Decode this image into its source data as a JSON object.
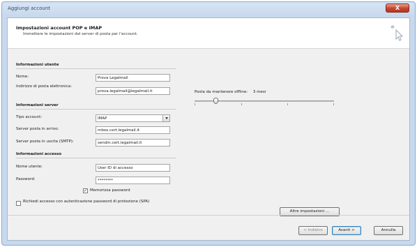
{
  "window": {
    "title": "Aggiungi account",
    "close_label": "X"
  },
  "header": {
    "title": "Impostazioni account POP e IMAP",
    "subtitle": "Immettere le impostazioni del server di posta per l'account."
  },
  "user_info": {
    "heading": "Informazioni utente",
    "name_label": "Nome:",
    "name_value": "Prova Legalmail",
    "email_label": "Indirizzo di posta elettronica:",
    "email_value": "prova.legalmail@legalmail.it"
  },
  "server_info": {
    "heading": "Informazioni server",
    "type_label": "Tipo account:",
    "type_value": "IMAP",
    "incoming_label": "Server posta in arrivo:",
    "incoming_value": "mbox.cert.legalmail.it",
    "outgoing_label": "Server posta in uscita (SMTP):",
    "outgoing_value": "sendm.cert.legalmail.it"
  },
  "logon_info": {
    "heading": "Informazioni accesso",
    "user_label": "Nome utente:",
    "user_value": "User ID di accesso",
    "password_label": "Password:",
    "password_value": "********",
    "remember_label": "Memorizza password",
    "remember_checked": true,
    "spa_label": "Richiedi accesso con autenticazione password di protezione (SPA)",
    "spa_checked": false
  },
  "offline": {
    "label": "Posta da mantenere offline:",
    "value": "3 mesi",
    "level": 0.15
  },
  "buttons": {
    "more_settings": "Altre impostazioni ...",
    "back": "< Indietro",
    "next": "Avanti >",
    "cancel": "Annulla"
  }
}
